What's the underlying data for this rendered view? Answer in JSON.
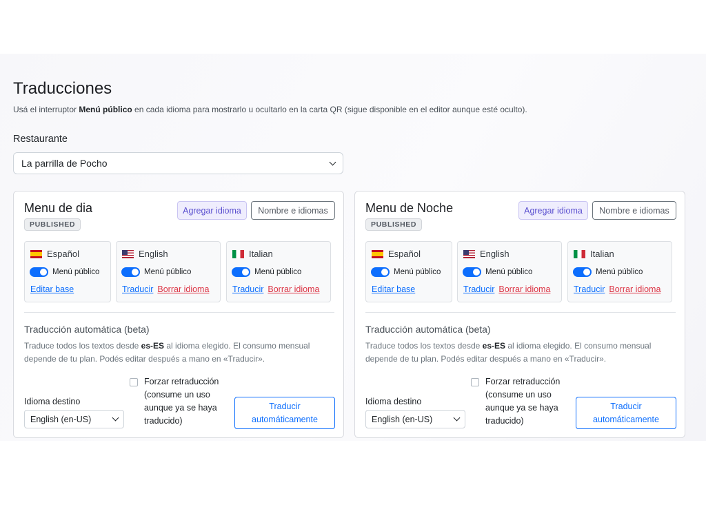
{
  "page": {
    "title": "Traducciones",
    "subtitle_pre": "Usá el interruptor ",
    "subtitle_bold": "Menú público",
    "subtitle_post": " en cada idioma para mostrarlo u ocultarlo en la carta QR (sigue disponible en el editor aunque esté oculto)."
  },
  "restaurant": {
    "label": "Restaurante",
    "selected": "La parrilla de Pocho"
  },
  "menus": [
    {
      "title": "Menu de dia",
      "status": "PUBLISHED",
      "add_language": "Agregar idioma",
      "names_languages": "Nombre e idiomas",
      "languages": [
        {
          "name": "Español",
          "flag": "flag-es",
          "toggle_label": "Menú público",
          "toggle_on": true,
          "link1": "Editar base",
          "link2": ""
        },
        {
          "name": "English",
          "flag": "flag-us",
          "toggle_label": "Menú público",
          "toggle_on": true,
          "link1": "Traducir",
          "link2": "Borrar idioma"
        },
        {
          "name": "Italian",
          "flag": "flag-it",
          "toggle_label": "Menú público",
          "toggle_on": true,
          "link1": "Traducir",
          "link2": "Borrar idioma"
        }
      ],
      "auto": {
        "title": "Traducción automática (beta)",
        "desc_pre": "Traduce todos los textos desde ",
        "desc_bold": "es-ES",
        "desc_post": " al idioma elegido. El consumo mensual depende de tu plan. Podés editar después a mano en «Traducir».",
        "dest_label": "Idioma destino",
        "dest_value": "English (en-US)",
        "force_label": "Forzar retraducción (consume un uso aunque ya se haya traducido)",
        "force_checked": false,
        "translate_button": "Traducir automáticamente"
      }
    },
    {
      "title": "Menu de Noche",
      "status": "PUBLISHED",
      "add_language": "Agregar idioma",
      "names_languages": "Nombre e idiomas",
      "languages": [
        {
          "name": "Español",
          "flag": "flag-es",
          "toggle_label": "Menú público",
          "toggle_on": true,
          "link1": "Editar base",
          "link2": ""
        },
        {
          "name": "English",
          "flag": "flag-us",
          "toggle_label": "Menú público",
          "toggle_on": true,
          "link1": "Traducir",
          "link2": "Borrar idioma"
        },
        {
          "name": "Italian",
          "flag": "flag-it",
          "toggle_label": "Menú público",
          "toggle_on": true,
          "link1": "Traducir",
          "link2": "Borrar idioma"
        }
      ],
      "auto": {
        "title": "Traducción automática (beta)",
        "desc_pre": "Traduce todos los textos desde ",
        "desc_bold": "es-ES",
        "desc_post": " al idioma elegido. El consumo mensual depende de tu plan. Podés editar después a mano en «Traducir».",
        "dest_label": "Idioma destino",
        "dest_value": "English (en-US)",
        "force_label": "Forzar retraducción (consume un uso aunque ya se haya traducido)",
        "force_checked": false,
        "translate_button": "Traducir automáticamente"
      }
    }
  ],
  "colors": {
    "primary": "#0d6efd",
    "danger": "#dc3545",
    "accent_soft": "#efedfd",
    "accent_text": "#5a4fcf"
  }
}
